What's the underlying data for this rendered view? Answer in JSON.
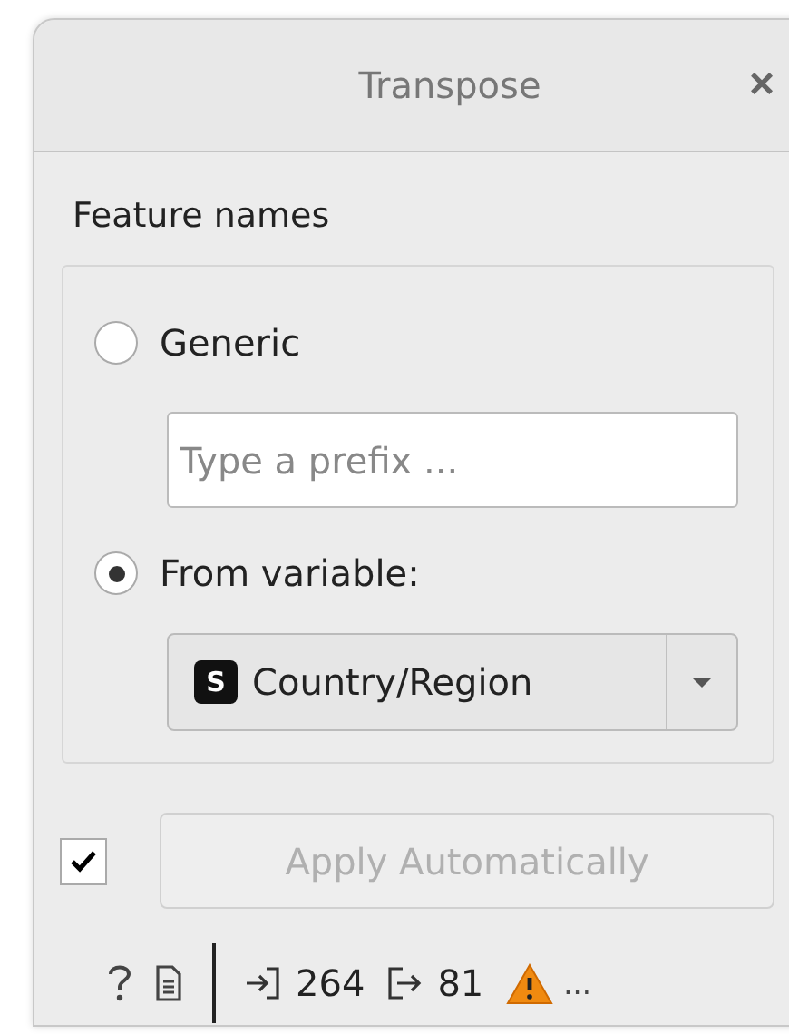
{
  "window": {
    "title": "Transpose",
    "close": "×"
  },
  "feature_names": {
    "title": "Feature names",
    "options": [
      {
        "label": "Generic",
        "selected": false
      },
      {
        "label": "From variable:",
        "selected": true
      }
    ],
    "prefix": {
      "placeholder": "Type a prefix ..."
    },
    "variable": {
      "type_badge": "S",
      "value": "Country/Region"
    }
  },
  "apply": {
    "checked": true,
    "label": "Apply Automatically",
    "disabled": true
  },
  "status_bar": {
    "input_count": "264",
    "output_count": "81",
    "warning": true,
    "more": "..."
  }
}
